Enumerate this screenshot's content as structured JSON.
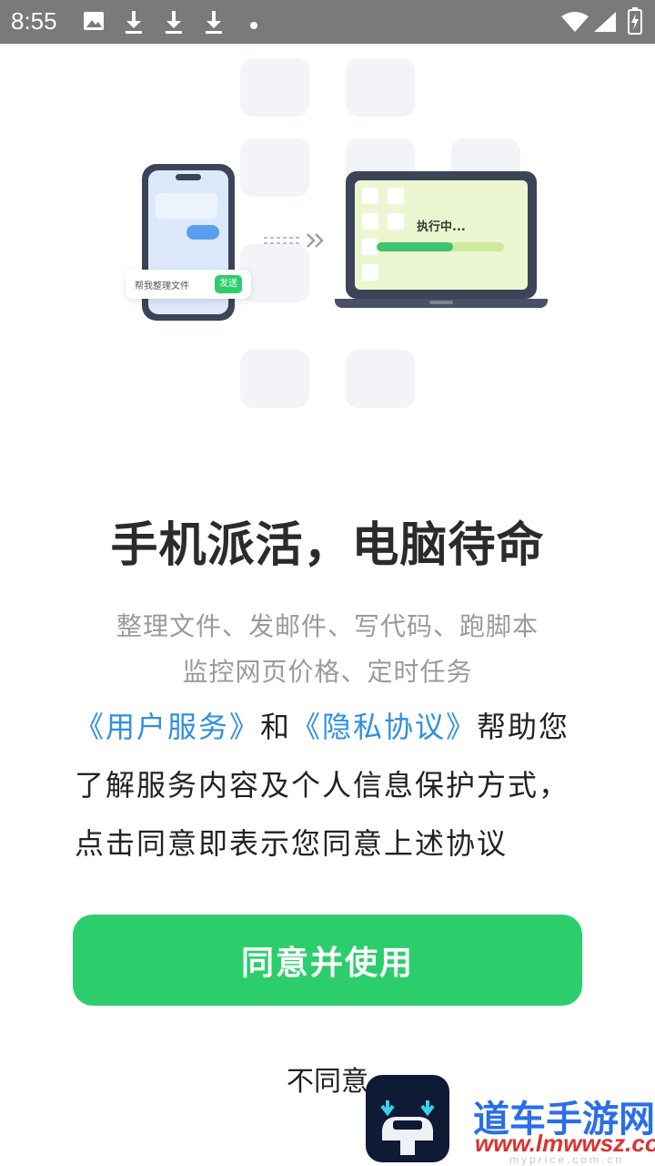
{
  "status_bar": {
    "time": "8:55",
    "icons": [
      "image-icon",
      "download-icon",
      "download-icon",
      "download-icon",
      "dot-icon",
      "wifi-icon",
      "signal-icon",
      "battery-charging-icon"
    ]
  },
  "illustration": {
    "phone_chip_text": "帮我整理文件",
    "phone_send_label": "发送",
    "laptop_status": "执行中...",
    "progress": 0.6
  },
  "headline": "手机派活，电脑待命",
  "subline_1": "整理文件、发邮件、写代码、跑脚本",
  "subline_2": "监控网页价格、定时任务",
  "agreement": {
    "user_service_link": "《用户服务》",
    "and": "和",
    "privacy_link": "《隐私协议》",
    "body": "帮助您了解服务内容及个人信息保护方式，点击同意即表示您同意上述协议"
  },
  "buttons": {
    "agree": "同意并使用",
    "disagree": "不同意"
  },
  "watermark": {
    "site_name": "道车手游网",
    "site_url": "www.lmwwsz.com",
    "site_tiny": "mypricе.com.cn"
  },
  "colors": {
    "accent_green": "#2cce6c",
    "link_blue": "#2f8fe0",
    "status_bar": "#7a7a7a"
  }
}
